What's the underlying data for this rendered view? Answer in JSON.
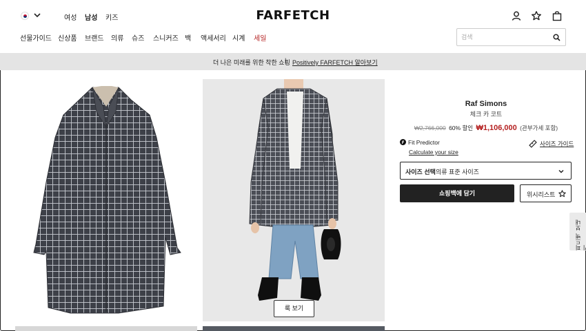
{
  "header": {
    "logo": "FARFETCH",
    "gender_tabs": [
      "여성",
      "남성",
      "키즈"
    ],
    "active_gender": "남성",
    "categories": [
      "선물가이드",
      "신상품",
      "브랜드",
      "의류",
      "슈즈",
      "스니커즈",
      "백",
      "액세서리",
      "시계",
      "세일"
    ],
    "sale_color": "#b41f1f",
    "search_placeholder": "검색",
    "icons": [
      "kr-flag-icon",
      "chevron-down-icon",
      "account-icon",
      "wishlist-star-icon",
      "shopping-bag-icon",
      "search-icon"
    ]
  },
  "banner": {
    "text": "더 나은 미래를 위한 착한 쇼핑",
    "separator": "|",
    "link": "Positively FARFETCH 알아보기"
  },
  "gallery": {
    "look_button": "룩 보기"
  },
  "product": {
    "brand": "Raf Simons",
    "name": "체크 카 코트",
    "old_price": "₩2,766,000",
    "discount": "60% 할인",
    "new_price": "₩1,106,000",
    "tax_note": "(관부가세 포함)",
    "fit_predictor": "Fit Predictor",
    "calculate_size": "Calculate your size",
    "size_guide": "사이즈 가이드",
    "size_select_bold": "사이즈 선택",
    "size_select_text": "의류 표준 사이즈",
    "add_to_bag": "쇼핑백에 담기",
    "wishlist": "위시리스트",
    "price_color": "#b41f1f"
  },
  "feedback": {
    "label": "피드백 보내기"
  }
}
